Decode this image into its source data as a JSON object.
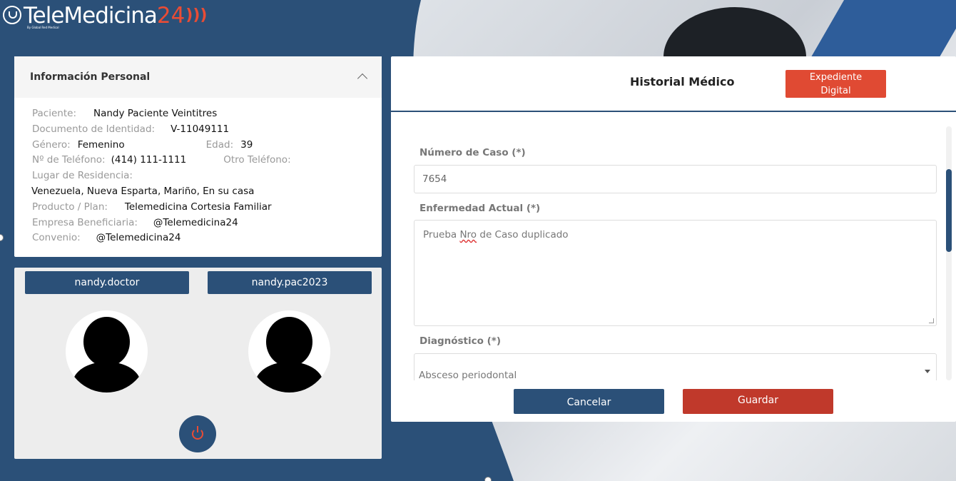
{
  "logo": {
    "text": "TeleMedicina",
    "number": "24",
    "waves": ")))",
    "subtitle": "By Global Red Medical"
  },
  "personal_info": {
    "title": "Información Personal",
    "patient_label": "Paciente:",
    "patient_value": "Nandy Paciente Veintitres",
    "document_label": "Documento de Identidad:",
    "document_value": "V-11049111",
    "gender_label": "Género:",
    "gender_value": "Femenino",
    "age_label": "Edad:",
    "age_value": "39",
    "phone_label": "Nº de Teléfono:",
    "phone_value": "(414) 111-1111",
    "other_phone_label": "Otro Teléfono:",
    "residence_label": "Lugar de Residencia:",
    "residence_value": "Venezuela, Nueva Esparta, Mariño, En su casa",
    "plan_label": "Producto / Plan:",
    "plan_value": "Telemedicina Cortesia Familiar",
    "company_label": "Empresa Beneficiaria:",
    "company_value": "@Telemedicina24",
    "agreement_label": "Convenio:",
    "agreement_value": "@Telemedicina24"
  },
  "users": {
    "doctor": "nandy.doctor",
    "patient": "nandy.pac2023"
  },
  "history": {
    "title": "Historial Médico",
    "expediente_line1": "Expediente",
    "expediente_line2": "Digital",
    "case_label": "Número de Caso (*)",
    "case_value": "7654",
    "illness_label": "Enfermedad Actual (*)",
    "illness_pre": "Prueba ",
    "illness_misspelled": "Nro",
    "illness_post": " de Caso duplicado",
    "diagnosis_label": "Diagnóstico (*)",
    "diagnosis_value": "Absceso periodontal",
    "cancel_label": "Cancelar",
    "save_label": "Guardar"
  },
  "icons": {
    "power": "power-icon",
    "collapse": "chevron-up-icon",
    "avatar": "user-avatar-icon"
  },
  "colors": {
    "primary": "#2b5078",
    "accent": "#e04a33",
    "save": "#c0392b"
  }
}
